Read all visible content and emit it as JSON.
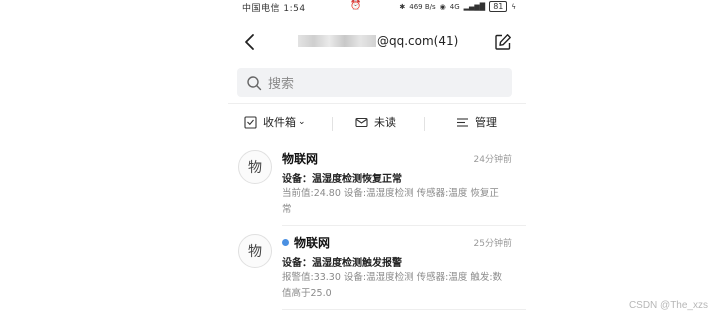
{
  "status_bar": {
    "carrier": "中国电信 1:54",
    "net_speed": "469\nB/s",
    "signal": "4G",
    "battery": "81"
  },
  "header": {
    "title_suffix": "@qq.com(41)"
  },
  "search": {
    "placeholder": "搜索"
  },
  "filters": {
    "inbox": "收件箱",
    "unread": "未读",
    "manage": "管理"
  },
  "mails": [
    {
      "avatar": "物",
      "sender": "物联网",
      "time": "24分钟前",
      "subject": "设备：温湿度检测恢复正常",
      "preview": "当前值:24.80 设备:温湿度检测 传感器:温度 恢复正常",
      "unread": false
    },
    {
      "avatar": "物",
      "sender": "物联网",
      "time": "25分钟前",
      "subject": "设备：温湿度检测触发报警",
      "preview": "报警值:33.30 设备:温湿度检测 传感器:温度 触发:数值高于25.0",
      "unread": true
    }
  ],
  "watermark": "CSDN @The_xzs",
  "colors": {
    "unread_dot": "#4a90e2",
    "search_bg": "#f1f2f4"
  }
}
